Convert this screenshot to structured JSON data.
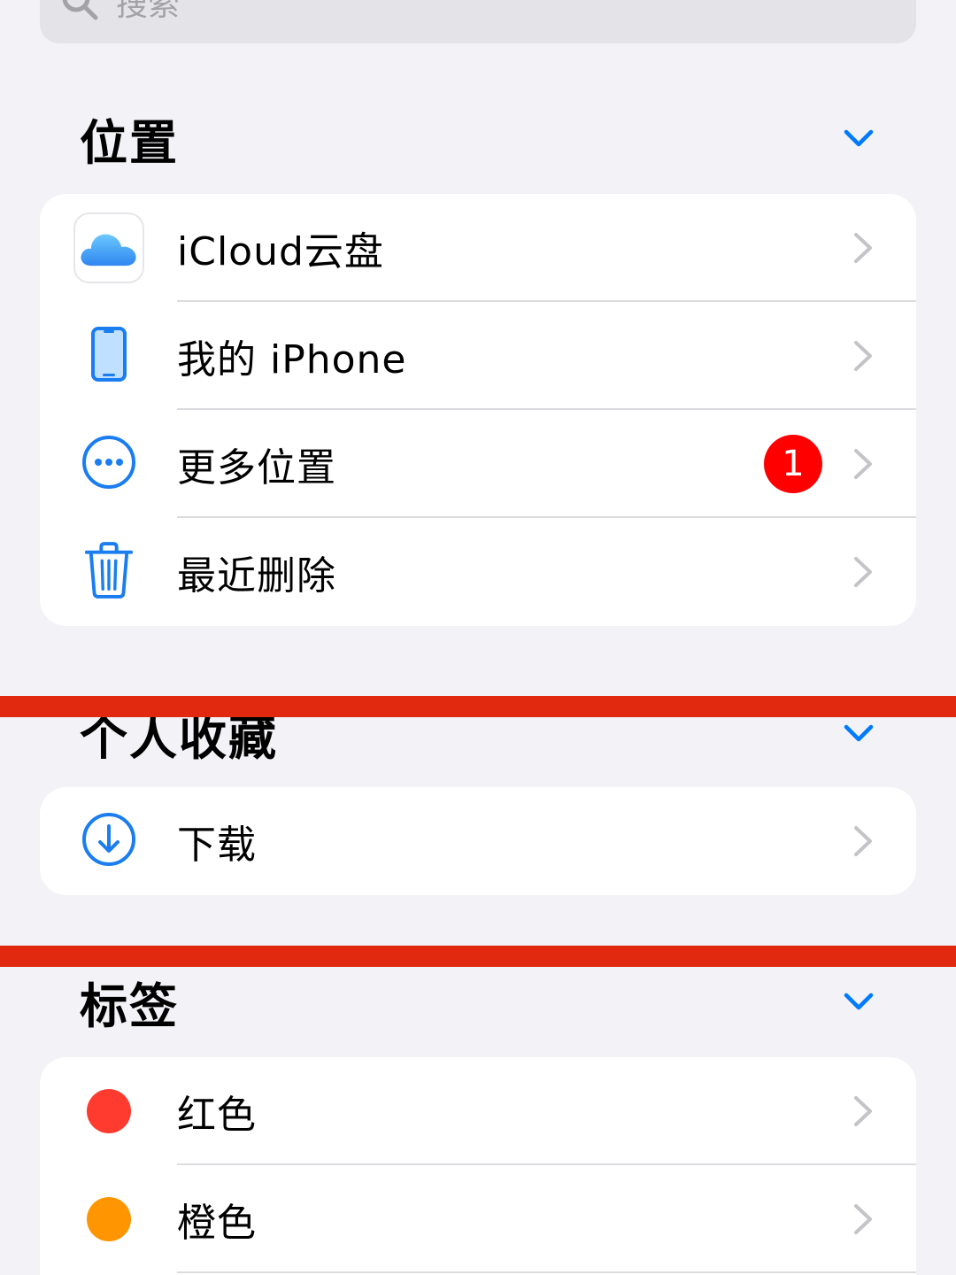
{
  "search": {
    "placeholder": "搜索"
  },
  "sections": {
    "locations": {
      "title": "位置",
      "items": [
        {
          "label": "iCloud云盘",
          "icon": "icloud-icon"
        },
        {
          "label": "我的 iPhone",
          "icon": "iphone-icon"
        },
        {
          "label": "更多位置",
          "icon": "more-icon",
          "badge": "1"
        },
        {
          "label": "最近删除",
          "icon": "trash-icon"
        }
      ]
    },
    "favorites": {
      "title": "个人收藏",
      "items": [
        {
          "label": "下载",
          "icon": "download-icon"
        }
      ]
    },
    "tags": {
      "title": "标签",
      "items": [
        {
          "label": "红色",
          "color": "#ff3b30"
        },
        {
          "label": "橙色",
          "color": "#ff9500"
        }
      ]
    }
  },
  "colors": {
    "accent": "#007aff",
    "badge": "#ff0000",
    "annotation_line": "#e0290f"
  }
}
